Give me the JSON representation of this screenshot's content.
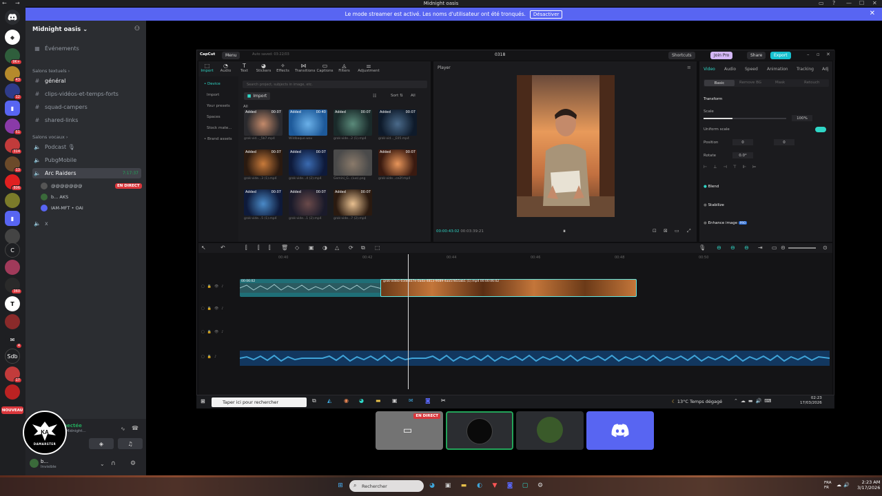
{
  "window": {
    "title": "Midnight oasis",
    "minimize": "—",
    "maximize": "☐",
    "close": "✕"
  },
  "banner": {
    "text": "Le mode streamer est activé. Les noms d'utilisateur ont été tronqués.",
    "deactivate": "Désactiver",
    "close": "✕"
  },
  "rail": {
    "nouveau": "NOUVEAU",
    "badges": [
      "9K+",
      "43",
      "12",
      "51",
      "314",
      "13",
      "806",
      "360",
      "4",
      "17",
      "4"
    ],
    "letter_servers": [
      "C",
      "Sdb"
    ]
  },
  "sidebar": {
    "server_name": "Midnight oasis",
    "events": "Événements",
    "text_category": "Salons textuels",
    "text_channels": [
      "général",
      "clips-vidéos-et-temps-forts",
      "squad-campers",
      "shared-links"
    ],
    "voice_category": "Salons vocaux",
    "voice_channels": [
      "Podcast",
      "PubgMobile",
      "Arc Raiders",
      "x"
    ],
    "arc_timer": "7:17:37",
    "voice_users": [
      "@@@@@@@",
      "b... AKS",
      "IAM-MFT • OAI"
    ],
    "live_tag": "EN DIRECT"
  },
  "voice_panel": {
    "status": "Voix connectée",
    "sub": "Arc Raiders / Midnight...",
    "user_name": "b...",
    "user_status": "Invisible",
    "logo_text": "DAMARSTER"
  },
  "capcut": {
    "top_title": "0318",
    "menu": "Menu",
    "autosave": "Auto saved: 03:22/03",
    "shortcuts": "Shortcuts",
    "join_pro": "Join Pro",
    "share": "Share",
    "export": "Export",
    "media_tabs": [
      "Import",
      "Audio",
      "Text",
      "Stickers",
      "Effects",
      "Transitions",
      "Captions",
      "Filters",
      "Adjustment"
    ],
    "media_nav": [
      "• Device",
      "Import",
      "Your presets",
      "Spaces",
      "Stock mate...",
      "• Brand assets"
    ],
    "search_placeholder": "Search project, subjects in image, etc.",
    "import_btn": "Import",
    "all_label": "All",
    "sort_label": "Sort",
    "all_btn": "All",
    "thumbs": [
      {
        "tag": "Added",
        "dur": "00:07",
        "cap": "grok-vid..._5b7.mp4"
      },
      {
        "tag": "Added",
        "dur": "00:40",
        "cap": "Wildbaque.wav"
      },
      {
        "tag": "Added",
        "dur": "00:07",
        "cap": "grok-vide...2 (1).mp4"
      },
      {
        "tag": "Added",
        "dur": "00:07",
        "cap": "grok-vid..._E05.mp4"
      },
      {
        "tag": "Added",
        "dur": "00:07",
        "cap": "grok-vide...3 (1).mp4"
      },
      {
        "tag": "Added",
        "dur": "00:07",
        "cap": "grok-vide...4 (2).mp4"
      },
      {
        "tag": "",
        "dur": "",
        "cap": "Gemini_G...(iuo).png"
      },
      {
        "tag": "Added",
        "dur": "00:07",
        "cap": "grok-vide...ce2f.mp4"
      },
      {
        "tag": "Added",
        "dur": "00:07",
        "cap": "grok-vide...5 (1).mp4"
      },
      {
        "tag": "Added",
        "dur": "00:07",
        "cap": "grok-vide...1 (2).mp4"
      },
      {
        "tag": "Added",
        "dur": "00:07",
        "cap": "grok-vide...7 (2).mp4"
      }
    ],
    "player_title": "Player",
    "player_time": "00:00:43:02",
    "player_total": "00:03:39:21",
    "inspector_tabs": [
      "Video",
      "Audio",
      "Speed",
      "Animation",
      "Tracking",
      "Adj"
    ],
    "inspector_subtabs": [
      "Basic",
      "Remove BG",
      "Mask",
      "Retouch"
    ],
    "transform": "Transform",
    "scale": "Scale",
    "scale_value": "100%",
    "scale_fraction": 0.35,
    "uniform_scale": "Uniform scale",
    "position": "Position",
    "pos_x": "0",
    "pos_y": "0",
    "rotate": "Rotate",
    "rotate_value": "0.0°",
    "blend": "Blend",
    "stabilize": "Stabilize",
    "enhance": "Enhance image",
    "pro_badge": "PRO",
    "ruler": [
      "00:40",
      "00:42",
      "00:44",
      "00:46",
      "00:48",
      "00:50"
    ],
    "clip1_label": "00:06:02",
    "clip2_label": "grok-video-03de837e-0ada-4813-9089-4aa57855ab1 (1).mp4  00:00:06:02"
  },
  "inner_taskbar": {
    "search": "Taper ici pour rechercher",
    "weather": "13°C  Temps dégagé",
    "time": "02:23",
    "date": "17/03/2026"
  },
  "tiles": {
    "live_tag": "EN DIRECT"
  },
  "taskbar": {
    "search": "Rechercher",
    "lang": "FRA\nFR",
    "time": "2:23 AM",
    "date": "3/17/2026"
  }
}
